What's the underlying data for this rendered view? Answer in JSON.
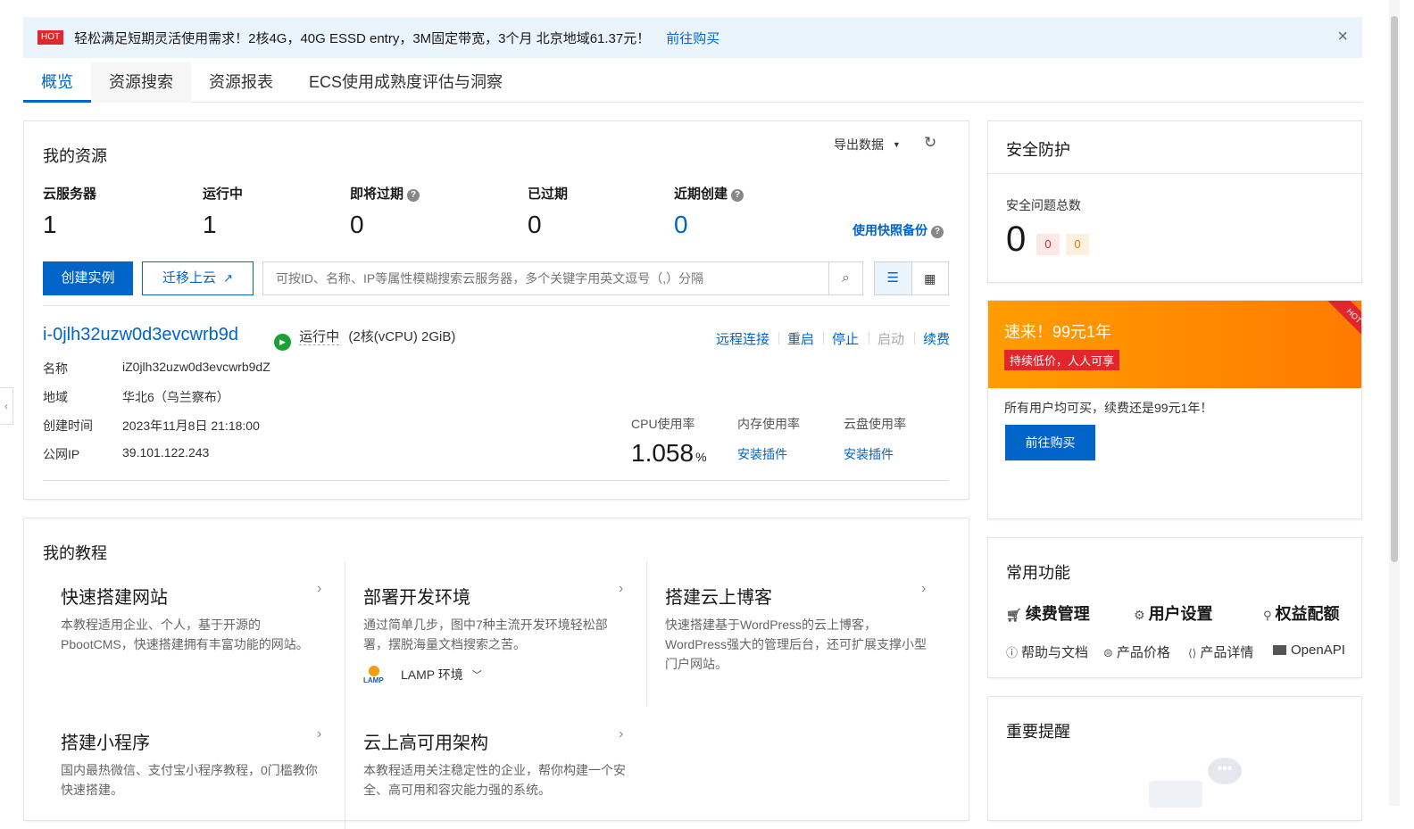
{
  "banner": {
    "tag": "HOT",
    "text": "轻松满足短期灵活使用需求！2核4G，40G ESSD entry，3M固定带宽，3个月 北京地域61.37元！",
    "link": "前往购买",
    "close": "×"
  },
  "tabs": [
    "概览",
    "资源搜索",
    "资源报表",
    "ECS使用成熟度评估与洞察"
  ],
  "resources": {
    "title": "我的资源",
    "export_label": "导出数据",
    "refresh_icon": "refresh-icon",
    "stats": [
      {
        "label": "云服务器",
        "value": "1"
      },
      {
        "label": "运行中",
        "value": "1"
      },
      {
        "label": "即将过期",
        "value": "0"
      },
      {
        "label": "已过期",
        "value": "0"
      },
      {
        "label": "近期创建",
        "value": "0"
      },
      {
        "label": "快照",
        "value": "使用快照备份"
      }
    ],
    "create_button": "创建实例",
    "migrate_button": "迁移上云",
    "search_placeholder": "可按ID、名称、IP等属性模糊搜索云服务器，多个关键字用英文逗号（,）分隔"
  },
  "instance": {
    "id": "i-0jlh32uzw0d3evcwrb9d",
    "status": "运行中",
    "spec": "(2核(vCPU) 2GiB)",
    "ops": [
      "远程连接",
      "重启",
      "停止",
      "启动",
      "续费"
    ],
    "fields": [
      {
        "k": "名称",
        "v": "iZ0jlh32uzw0d3evcwrb9dZ"
      },
      {
        "k": "地域",
        "v": "华北6（乌兰察布）"
      },
      {
        "k": "创建时间",
        "v": "2023年11月8日 21:18:00"
      },
      {
        "k": "公网IP",
        "v": "39.101.122.243"
      }
    ],
    "cpu_label": "CPU使用率",
    "cpu_value": "1.058",
    "cpu_unit": "%",
    "mem_label": "内存使用率",
    "mem_link": "安装插件",
    "disk_label": "云盘使用率",
    "disk_link": "安装插件"
  },
  "tutorials": {
    "title": "我的教程",
    "items": [
      {
        "title": "快速搭建网站",
        "desc": "本教程适用企业、个人，基于开源的PbootCMS，快速搭建拥有丰富功能的网站。"
      },
      {
        "title": "部署开发环境",
        "desc": "通过简单几步，图中7种主流开发环境轻松部署，摆脱海量文档搜索之苦。",
        "env": "LAMP 环境"
      },
      {
        "title": "搭建云上博客",
        "desc": "快速搭建基于WordPress的云上博客，WordPress强大的管理后台，还可扩展支撑小型门户网站。"
      },
      {
        "title": "搭建小程序",
        "desc": "国内最热微信、支付宝小程序教程，0门槛教你快速搭建。"
      },
      {
        "title": "云上高可用架构",
        "desc": "本教程适用关注稳定性的企业，帮你构建一个安全、高可用和容灾能力强的系统。"
      }
    ]
  },
  "security": {
    "title": "安全防护",
    "label": "安全问题总数",
    "total": "0",
    "badge_red": "0",
    "badge_orange": "0"
  },
  "promo": {
    "title": "速来！99元1年",
    "tag": "持续低价，人人可享",
    "corner": "HOT",
    "desc": "所有用户均可买，续费还是99元1年！",
    "button": "前往购买"
  },
  "common": {
    "title": "常用功能",
    "primary": [
      "续费管理",
      "用户设置",
      "权益配额"
    ],
    "secondary": [
      "帮助与文档",
      "产品价格",
      "产品详情",
      "OpenAPI"
    ]
  },
  "reminder": {
    "title": "重要提醒"
  },
  "colors": {
    "accent": "#0064c8",
    "running": "#1aa033",
    "promo": "#ff8a00"
  }
}
